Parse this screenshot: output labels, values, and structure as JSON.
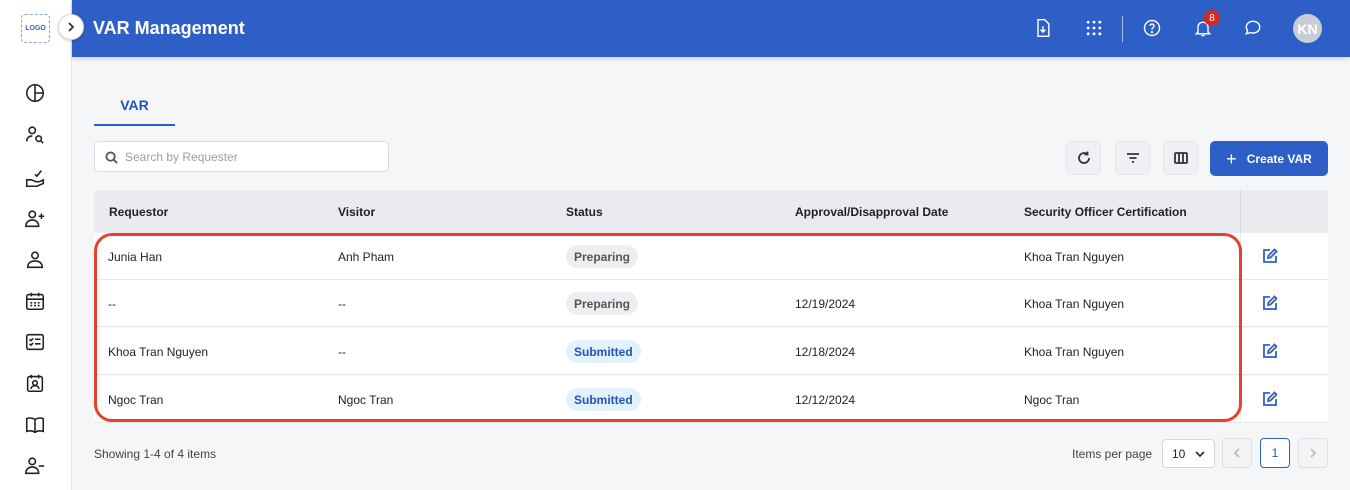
{
  "app": {
    "logo_text": "LOGO",
    "title": "VAR Management"
  },
  "header": {
    "notification_count": "8",
    "avatar_initials": "KN"
  },
  "tabs": [
    {
      "label": "VAR"
    }
  ],
  "search": {
    "placeholder": "Search by Requester",
    "value": ""
  },
  "toolbar": {
    "create_label": "Create VAR"
  },
  "table": {
    "columns": [
      "Requestor",
      "Visitor",
      "Status",
      "Approval/Disapproval Date",
      "Security Officer Certification"
    ],
    "rows": [
      {
        "requestor": "Junia Han",
        "visitor": "Anh Pham",
        "status": "Preparing",
        "date": "",
        "certification": "Khoa Tran Nguyen"
      },
      {
        "requestor": "--",
        "visitor": "--",
        "status": "Preparing",
        "date": "12/19/2024",
        "certification": "Khoa Tran Nguyen"
      },
      {
        "requestor": "Khoa Tran Nguyen",
        "visitor": "--",
        "status": "Submitted",
        "date": "12/18/2024",
        "certification": "Khoa Tran Nguyen"
      },
      {
        "requestor": "Ngoc Tran",
        "visitor": "Ngoc Tran",
        "status": "Submitted",
        "date": "12/12/2024",
        "certification": "Ngoc Tran"
      }
    ]
  },
  "footer": {
    "showing": "Showing 1-4 of 4 items",
    "items_per_page_label": "Items per page",
    "items_per_page_value": "10",
    "current_page": "1"
  },
  "colors": {
    "brand": "#2e5fc7",
    "highlight": "#e8402e",
    "badge": "#d9281f"
  }
}
